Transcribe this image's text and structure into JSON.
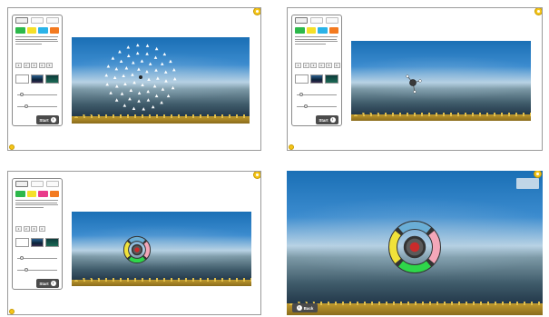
{
  "panels": [
    {
      "id": "panel-1",
      "sidebar": {
        "modes": [
          "",
          "",
          ""
        ],
        "colors": [
          {
            "label": "",
            "color": "#2db84b"
          },
          {
            "label": "",
            "color": "#f5e02a"
          },
          {
            "label": "",
            "color": "#2ab3e8"
          },
          {
            "label": "",
            "color": "#f37a20"
          }
        ],
        "numbers_label": "",
        "numbers": [
          "1",
          "2",
          "3",
          "4",
          "5"
        ],
        "background_label": "",
        "speed_label": "",
        "speed_value": "",
        "size_label": "",
        "size_value": "",
        "start_label": "Start"
      },
      "corner_label_1": "",
      "corner_label_2": "",
      "scene": "fish-school"
    },
    {
      "id": "panel-2",
      "sidebar": {
        "modes": [
          "",
          "",
          ""
        ],
        "colors": [
          {
            "label": "",
            "color": "#2db84b"
          },
          {
            "label": "",
            "color": "#f5e02a"
          },
          {
            "label": "",
            "color": "#2ab3e8"
          },
          {
            "label": "",
            "color": "#f37a20"
          }
        ],
        "numbers_label": "",
        "numbers": [
          "1",
          "2",
          "3",
          "4",
          "5",
          "6"
        ],
        "background_label": "",
        "speed_label": "",
        "speed_value": "",
        "size_label": "",
        "size_value": "",
        "start_label": "Start"
      },
      "corner_label_1": "",
      "corner_label_2": "",
      "scene": "spinner"
    },
    {
      "id": "panel-3",
      "sidebar": {
        "modes": [
          "",
          "",
          ""
        ],
        "colors": [
          {
            "label": "",
            "color": "#2db84b"
          },
          {
            "label": "",
            "color": "#f5e02a"
          },
          {
            "label": "",
            "color": "#e93a8a"
          },
          {
            "label": "",
            "color": "#f37a20"
          }
        ],
        "numbers_label": "",
        "numbers": [
          "1",
          "2",
          "3",
          "4"
        ],
        "background_label": "",
        "speed_label": "",
        "speed_value": "",
        "size_label": "",
        "size_value": "",
        "start_label": "Start"
      },
      "corner_label_1": "",
      "corner_label_2": "",
      "scene": "ring-small"
    },
    {
      "id": "panel-4",
      "back_label": "Back",
      "top_controls": {
        "row1_label": "",
        "row1_value": "",
        "row2_label": "",
        "row2_value": ""
      },
      "scene": "ring-large"
    }
  ],
  "colors": {
    "ring_blue": "#6aaed6",
    "ring_pink": "#f4a7b9",
    "ring_green": "#2ed64a",
    "ring_yellow": "#f0e23a",
    "ring_outline": "#333333",
    "ring_center": "#5a5a5a",
    "ring_dot": "#cc2b2b",
    "sand": "#c09a2e",
    "button_dark": "#4b4b4b",
    "accent_yellow": "#f5c518"
  }
}
